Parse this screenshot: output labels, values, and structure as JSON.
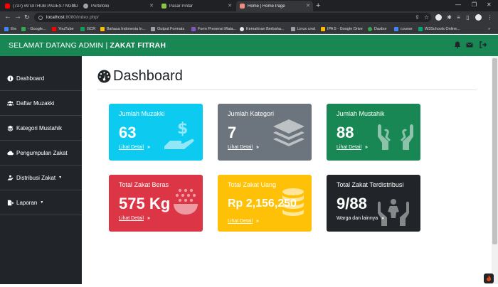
{
  "browser": {
    "tabs": [
      {
        "label": "(737) #9 GITHUB PAGES / NGOD...",
        "favicon_color": "#ff0000",
        "active": false
      },
      {
        "label": "Portofolio",
        "favicon_color": "#9aa0a6",
        "active": false
      },
      {
        "label": "Pasar Pintar",
        "favicon_color": "#8bc34a",
        "active": false
      },
      {
        "label": "Home | Home Page",
        "favicon_color": "#f28b82",
        "active": true
      }
    ],
    "new_tab_icon": "plus-icon",
    "url_host": "localhost",
    "url_path": ":8080/index.php/",
    "bookmarks": [
      {
        "label": "Ete",
        "color": "#4285f4"
      },
      {
        "label": "- Google...",
        "color": "#34a853"
      },
      {
        "label": "YouTube",
        "color": "#ff0000"
      },
      {
        "label": "GCR",
        "color": "#0f9d58"
      },
      {
        "label": "Bahasa Indonesia In...",
        "color": "#fbbc04"
      },
      {
        "label": "Output Formats",
        "color": "#9aa0a6"
      },
      {
        "label": "Form Presensi Mata...",
        "color": "#7e57c2"
      },
      {
        "label": "Kemahiran Berbaha...",
        "color": "#e8eaed"
      },
      {
        "label": "Linux cmd",
        "color": "#9aa0a6"
      },
      {
        "label": "IPA 5 - Google Drive",
        "color": "#fbbc04"
      },
      {
        "label": "Dasbor",
        "color": "#34a853"
      },
      {
        "label": "course",
        "color": "#4285f4"
      },
      {
        "label": "W3Schools Online...",
        "color": "#04aa6d"
      }
    ]
  },
  "navbar": {
    "brand_prefix": "SELAMAT DATANG ADMIN | ",
    "brand_bold": "ZAKAT FITRAH",
    "background": "#198754",
    "icons": [
      "bell-icon",
      "envelope-icon",
      "logout-icon"
    ]
  },
  "sidebar": {
    "items": [
      {
        "label": "Dashboard",
        "icon": "info-circle-icon",
        "dropdown": false
      },
      {
        "label": "Daftar Muzakki",
        "icon": "users-icon",
        "dropdown": false
      },
      {
        "label": "Kategori Mustahik",
        "icon": "layers-icon",
        "dropdown": false
      },
      {
        "label": "Pengumpulan Zakat",
        "icon": "cloud-icon",
        "dropdown": false
      },
      {
        "label": "Distribusi Zakat",
        "icon": "hand-holding-icon",
        "dropdown": true
      },
      {
        "label": "Laporan",
        "icon": "file-export-icon",
        "dropdown": true
      }
    ]
  },
  "main": {
    "title": "Dashboard",
    "title_icon": "gauge-icon",
    "cards": [
      {
        "label": "Jumlah Muzakki",
        "value": "63",
        "link": "Lihat Detail",
        "color": "#0dcaf0",
        "icon": "hand-holding-dollar-icon"
      },
      {
        "label": "Jumlah Kategori",
        "value": "7",
        "link": "Lihat Detail",
        "color": "#6c757d",
        "icon": "layers-icon"
      },
      {
        "label": "Jumlah Mustahik",
        "value": "88",
        "link": "Lihat Detail",
        "color": "#198754",
        "icon": "hands-icon"
      },
      {
        "label": "Total Zakat Beras",
        "value": "575 Kg",
        "link": "Lihat Detail",
        "color": "#dc3545",
        "icon": "rice-bowl-icon"
      },
      {
        "label": "Total Zakat Uang",
        "value": "Rp 2,156,250",
        "link": "Lihat Detail",
        "color": "#ffc107",
        "icon": "coins-icon"
      },
      {
        "label": "Total Zakat Terdistribusi",
        "value": "9/88",
        "link": "Warga dan lainnya",
        "color": "#212529",
        "icon": "hands-holding-child-icon"
      }
    ],
    "arrow_icon": "double-chevron-right-icon"
  }
}
